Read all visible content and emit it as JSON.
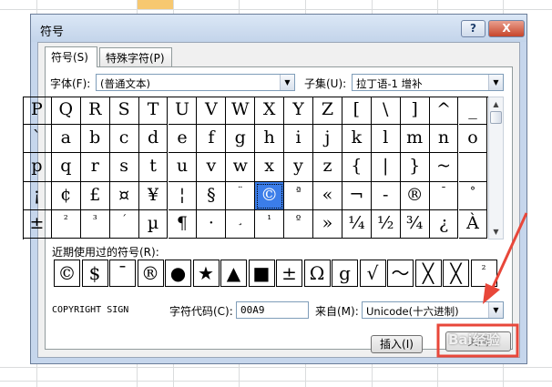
{
  "dialog": {
    "title": "符号",
    "help_label": "?",
    "close_label": "X"
  },
  "tabs": [
    {
      "label": "符号(S)",
      "active": true
    },
    {
      "label": "特殊字符(P)",
      "active": false
    }
  ],
  "font": {
    "label": "字体(F):",
    "value": "(普通文本)"
  },
  "subset": {
    "label": "子集(U):",
    "value": "拉丁语-1 增补"
  },
  "symbol_grid": [
    [
      "P",
      "Q",
      "R",
      "S",
      "T",
      "U",
      "V",
      "W",
      "X",
      "Y",
      "Z",
      "[",
      "\\",
      "]",
      "^",
      "_"
    ],
    [
      "`",
      "a",
      "b",
      "c",
      "d",
      "e",
      "f",
      "g",
      "h",
      "i",
      "j",
      "k",
      "l",
      "m",
      "n",
      "o"
    ],
    [
      "p",
      "q",
      "r",
      "s",
      "t",
      "u",
      "v",
      "w",
      "x",
      "y",
      "z",
      "{",
      "|",
      "}",
      "~",
      ""
    ],
    [
      "¡",
      "¢",
      "£",
      "¤",
      "¥",
      "¦",
      "§",
      "¨",
      "©",
      "ª",
      "«",
      "¬",
      "-",
      "®",
      "¯",
      "°"
    ],
    [
      "±",
      "²",
      "³",
      "´",
      "µ",
      "¶",
      "·",
      "¸",
      "¹",
      "º",
      "»",
      "¼",
      "½",
      "¾",
      "¿",
      "À"
    ]
  ],
  "selected_symbol": "©",
  "recent": {
    "label": "近期使用过的符号(R):",
    "symbols": [
      "©",
      "$",
      "¯",
      "®",
      "●",
      "★",
      "▲",
      "■",
      "±",
      "Ω",
      "g",
      "√",
      "～",
      "╳",
      "╳",
      "²"
    ]
  },
  "char_name": "COPYRIGHT SIGN",
  "char_code": {
    "label": "字符代码(C):",
    "value": "00A9"
  },
  "from": {
    "label": "来自(M):",
    "value": "Unicode(十六进制)"
  },
  "buttons": {
    "insert": "插入(I)",
    "cancel": "关闭"
  },
  "colors": {
    "accent": "#3b7de9",
    "annotation": "#e8473a"
  }
}
